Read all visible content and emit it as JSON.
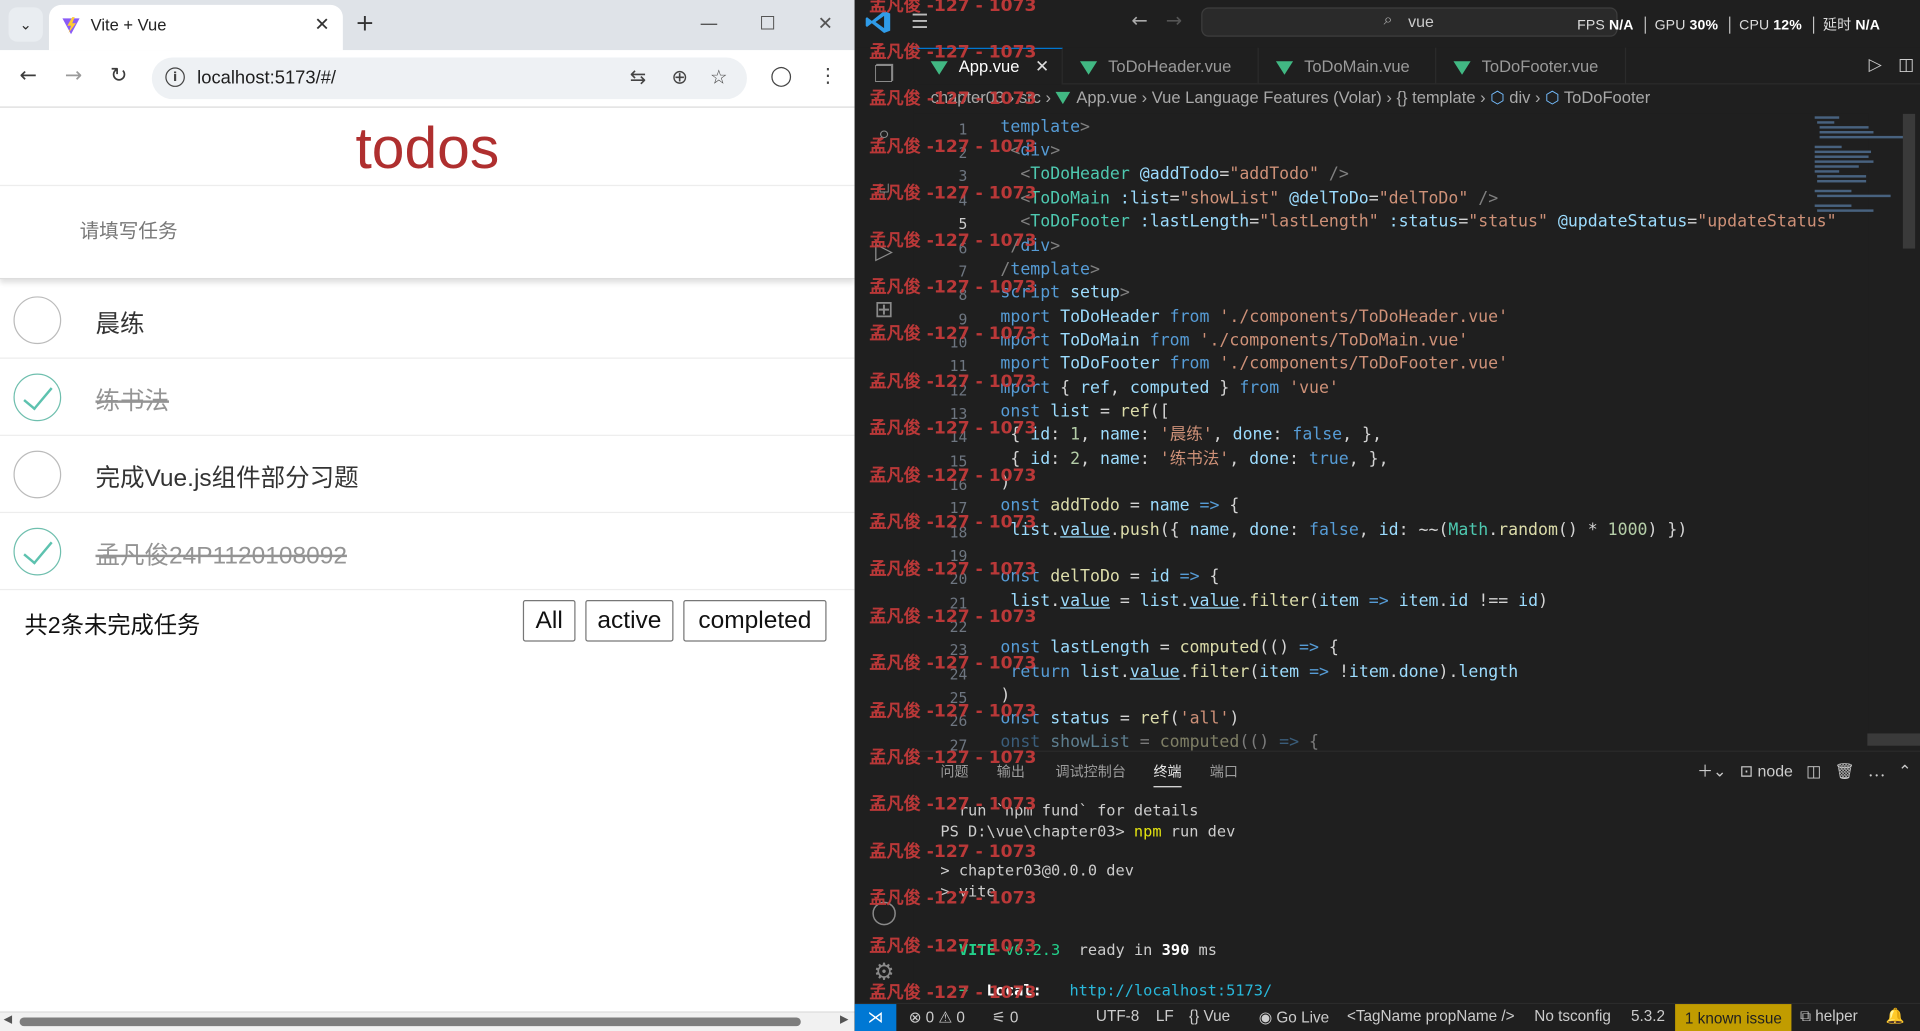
{
  "browser": {
    "tab_title": "Vite + Vue",
    "url": "localhost:5173/#/",
    "window_controls": {
      "minimize": "—",
      "maximize": "☐",
      "close": "✕"
    }
  },
  "app": {
    "title": "todos",
    "new_todo_placeholder": "请填写任务",
    "todos": [
      {
        "name": "晨练",
        "done": false
      },
      {
        "name": "练书法",
        "done": true
      },
      {
        "name": "完成Vue.js组件部分习题",
        "done": false
      },
      {
        "name": "孟凡俊24P1120108092",
        "done": true
      }
    ],
    "footer": {
      "count_text": "共2条未完成任务",
      "filters": [
        "All",
        "active",
        "completed"
      ]
    }
  },
  "vscode": {
    "search_text": "vue",
    "perf": {
      "fps_label": "FPS",
      "fps": "N/A",
      "gpu_label": "GPU",
      "gpu": "30%",
      "cpu_label": "CPU",
      "cpu": "12%",
      "delay_label": "延时",
      "delay": "N/A"
    },
    "tabs": [
      "App.vue",
      "ToDoHeader.vue",
      "ToDoMain.vue",
      "ToDoFooter.vue"
    ],
    "breadcrumb": [
      "chapter03",
      "src",
      "App.vue",
      "Vue Language Features (Volar)",
      "{} template",
      "div",
      "ToDoFooter"
    ],
    "panel_tabs": [
      "问题",
      "输出",
      "调试控制台",
      "终端",
      "端口"
    ],
    "panel_terminal_name": "node",
    "terminal": {
      "line1": "  run `npm fund` for details",
      "line2_prompt": "PS D:\\vue\\chapter03>",
      "line2_cmd": "npm",
      "line2_args": "run dev",
      "line3": "> chapter03@0.0.0 dev",
      "line4": "> vite",
      "vite_label": "VITE",
      "vite_version": "v6.2.3",
      "ready_a": "ready in",
      "ready_ms": "390",
      "ready_b": "ms",
      "local_label": "Local:",
      "local_url": "http://localhost:5173/"
    },
    "status": {
      "errors": "0",
      "warnings": "0",
      "ports": "0",
      "encoding": "UTF-8",
      "eol": "LF",
      "language": "Vue",
      "golive": "Go Live",
      "tag": "<TagName propName />",
      "tsconfig": "No tsconfig",
      "version": "5.3.2",
      "issue": "1 known issue",
      "helper": "helper"
    },
    "watermark": "孟凡俊 -127 - 1073"
  },
  "colors": {
    "todo_title": "#af2f2f",
    "check": "#5dc2af",
    "vscode_accent": "#0078d4",
    "issue_bg": "#c19c00"
  }
}
